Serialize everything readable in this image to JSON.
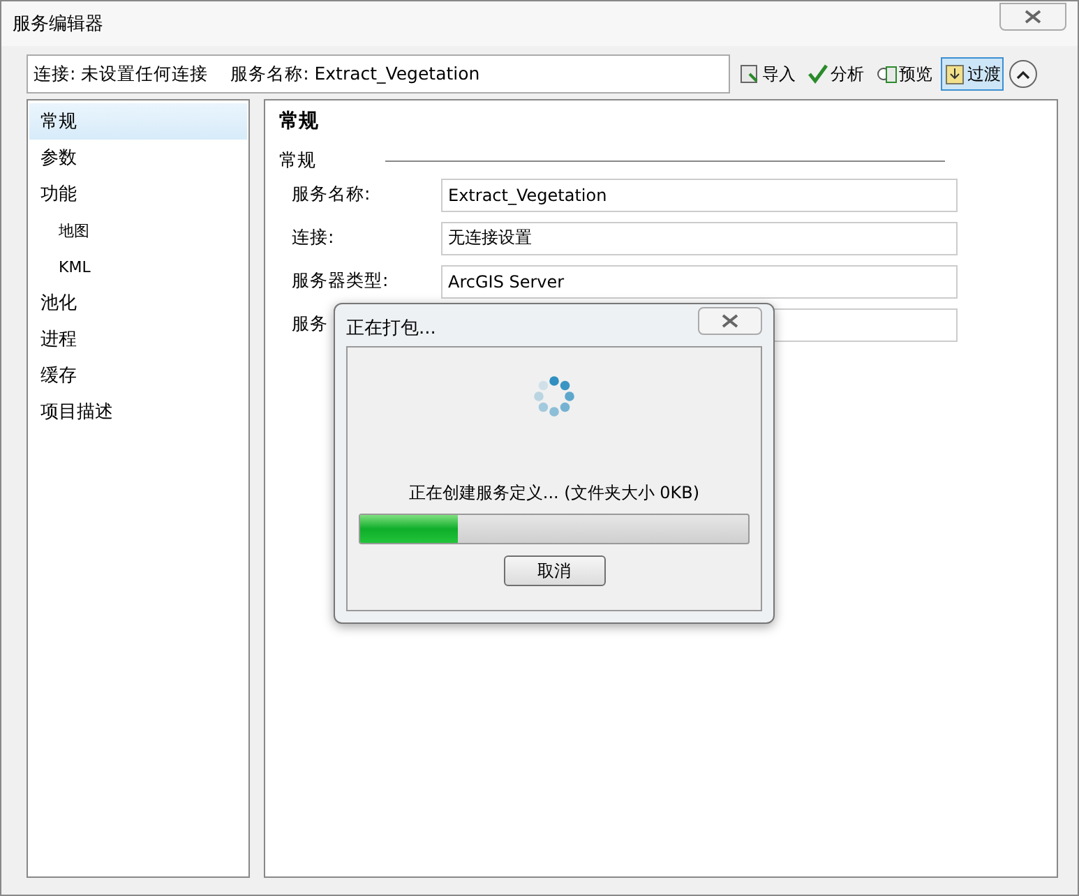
{
  "window": {
    "title": "服务编辑器"
  },
  "info_bar": {
    "text": "连接: 未设置任何连接    服务名称: Extract_Vegetation"
  },
  "toolbar": [
    {
      "kind": "import",
      "label": "导入",
      "selected": false
    },
    {
      "kind": "analyze",
      "label": "分析",
      "selected": false
    },
    {
      "kind": "preview",
      "label": "预览",
      "selected": false
    },
    {
      "kind": "publish",
      "label": "过渡",
      "selected": true
    }
  ],
  "sidebar": {
    "items": [
      {
        "label": "常规",
        "selected": true
      },
      {
        "label": "参数",
        "selected": false
      },
      {
        "label": "功能",
        "selected": false,
        "children": [
          {
            "label": "地图",
            "selected": false
          },
          {
            "label": "KML",
            "selected": false
          }
        ]
      },
      {
        "label": "池化",
        "selected": false
      },
      {
        "label": "进程",
        "selected": false
      },
      {
        "label": "缓存",
        "selected": false
      },
      {
        "label": "项目描述",
        "selected": false
      }
    ]
  },
  "content": {
    "heading": "常规",
    "section": "常规",
    "fields": [
      {
        "label": "服务名称:",
        "value": "Extract_Vegetation"
      },
      {
        "label": "连接:",
        "value": "无连接设置"
      },
      {
        "label": "服务器类型:",
        "value": "ArcGIS Server"
      },
      {
        "label": "服务"
      }
    ]
  },
  "dialog": {
    "title": "正在打包...",
    "status": "正在创建服务定义... (文件夹大小 0KB)",
    "level": 0.25,
    "button": "取消"
  }
}
